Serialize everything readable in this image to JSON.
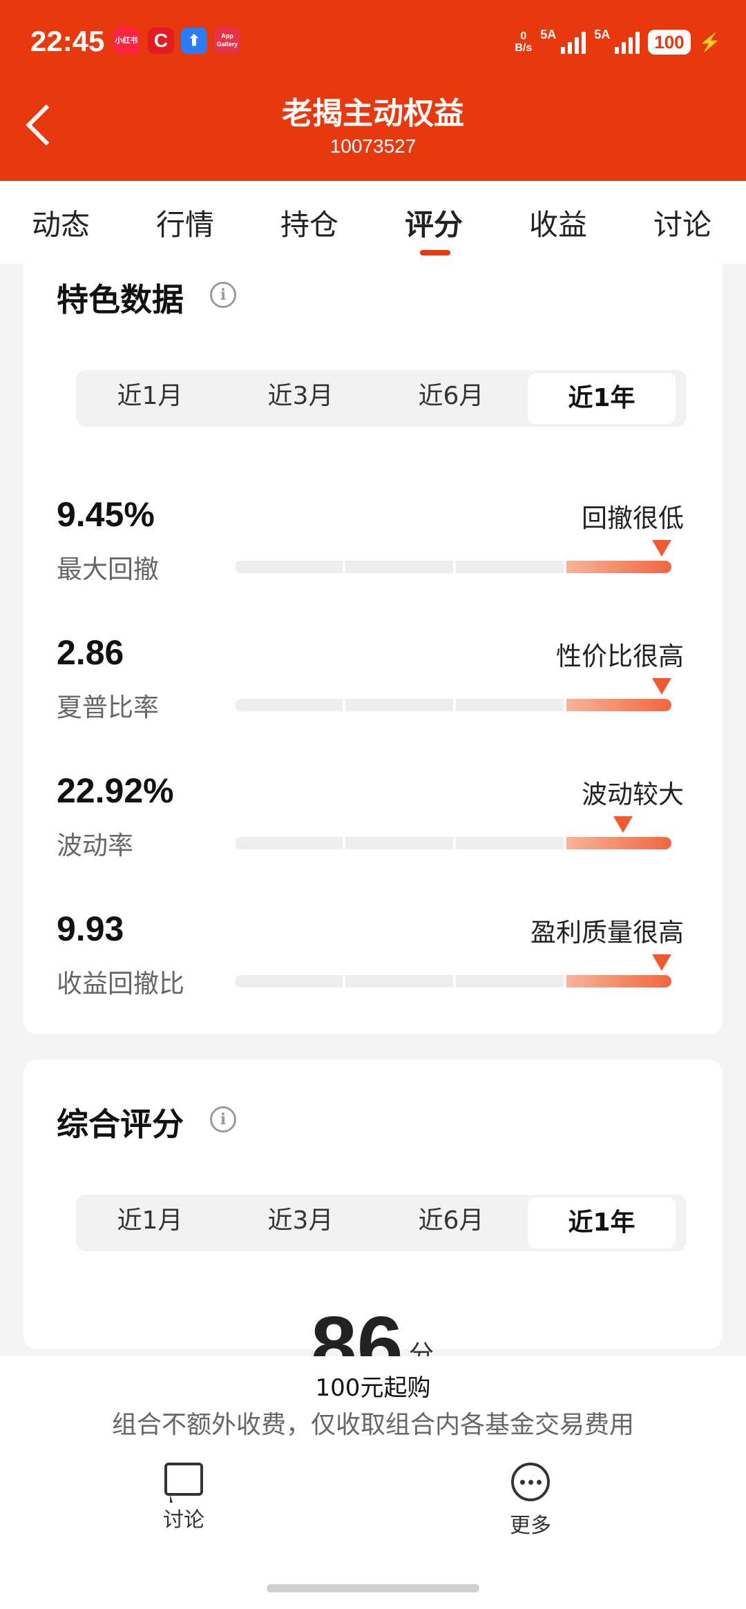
{
  "status_bar": {
    "time": "22:45",
    "app_icons": [
      "小红书",
      "C",
      "⬆",
      "App Gallery"
    ],
    "net_speed_value": "0",
    "net_speed_unit": "B/s",
    "sim1_label": "5A",
    "sim2_label": "5A",
    "battery": "100",
    "charging_glyph": "⚡"
  },
  "header": {
    "title": "老揭主动权益",
    "code": "10073527"
  },
  "tabs": [
    "动态",
    "行情",
    "持仓",
    "评分",
    "收益",
    "讨论"
  ],
  "active_tab": "评分",
  "feature_section": {
    "title": "特色数据",
    "info_glyph": "i",
    "periods": [
      "近1月",
      "近3月",
      "近6月",
      "近1年"
    ],
    "active_period": "近1年",
    "metrics": [
      {
        "value": "9.45%",
        "label": "最大回撤",
        "status": "回撤很低",
        "marker_position": 0.98
      },
      {
        "value": "2.86",
        "label": "夏普比率",
        "status": "性价比很高",
        "marker_position": 0.98
      },
      {
        "value": "22.92%",
        "label": "波动率",
        "status": "波动较大",
        "marker_position": 0.89
      },
      {
        "value": "9.93",
        "label": "收益回撤比",
        "status": "盈利质量很高",
        "marker_position": 0.98
      }
    ]
  },
  "score_section": {
    "title": "综合评分",
    "info_glyph": "i",
    "periods": [
      "近1月",
      "近3月",
      "近6月",
      "近1年"
    ],
    "active_period": "近1年",
    "score": "86",
    "score_unit": "分"
  },
  "bottom": {
    "min_purchase": "100元起购",
    "fee_note": "组合不额外收费，仅收取组合内各基金交易费用",
    "actions": [
      {
        "label": "讨论",
        "icon": "chat-bubble-icon"
      },
      {
        "label": "更多",
        "icon": "more-dots-icon"
      }
    ]
  },
  "colors": {
    "brand": "#e8390e",
    "marker": "#ef5a30"
  }
}
